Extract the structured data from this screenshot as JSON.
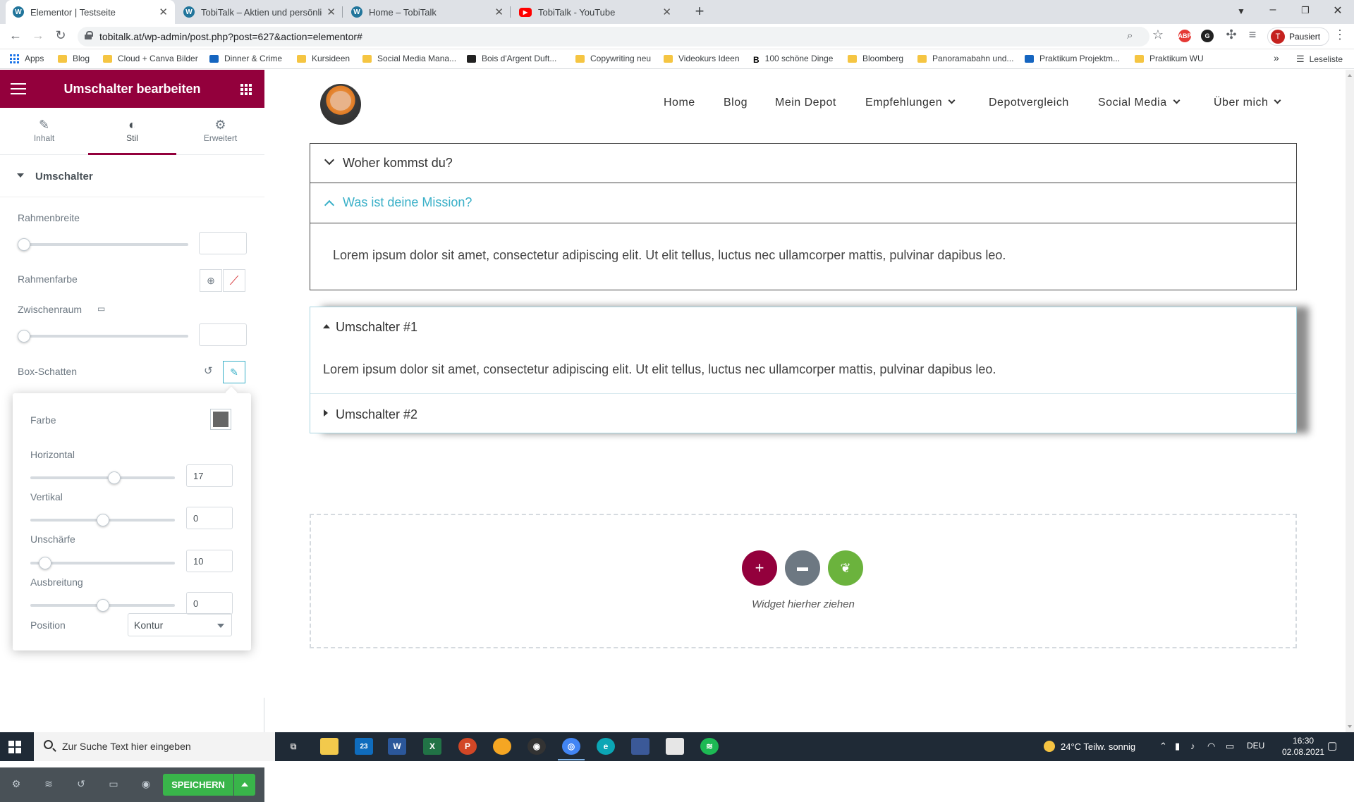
{
  "browser": {
    "tabs": [
      {
        "title": "Elementor | Testseite",
        "icon": "wordpress-icon"
      },
      {
        "title": "TobiTalk – Aktien und persönliche",
        "icon": "wordpress-icon"
      },
      {
        "title": "Home – TobiTalk",
        "icon": "wordpress-icon"
      },
      {
        "title": "TobiTalk - YouTube",
        "icon": "youtube-icon"
      }
    ],
    "new_tab": "+",
    "url": "tobitalk.at/wp-admin/post.php?post=627&action=elementor#",
    "profile_initial": "T",
    "profile_label": "Pausiert",
    "extensions": [
      "ABP",
      "G"
    ],
    "bookmarks": [
      {
        "label": "Apps"
      },
      {
        "label": "Blog"
      },
      {
        "label": "Cloud + Canva Bilder"
      },
      {
        "label": "Dinner & Crime"
      },
      {
        "label": "Kursideen"
      },
      {
        "label": "Social Media Mana..."
      },
      {
        "label": "Bois d'Argent Duft..."
      },
      {
        "label": "Copywriting neu"
      },
      {
        "label": "Videokurs Ideen"
      },
      {
        "label": "100 schöne Dinge"
      },
      {
        "label": "Bloomberg"
      },
      {
        "label": "Panoramabahn und..."
      },
      {
        "label": "Praktikum Projektm..."
      },
      {
        "label": "Praktikum WU"
      }
    ],
    "more_bookmarks": "»",
    "reading_list": "Leseliste"
  },
  "panel": {
    "title": "Umschalter bearbeiten",
    "tabs": [
      {
        "label": "Inhalt",
        "icon": "pencil-icon"
      },
      {
        "label": "Stil",
        "icon": "contrast-icon"
      },
      {
        "label": "Erweitert",
        "icon": "gear-icon"
      }
    ],
    "active_tab": "Stil",
    "section": "Umschalter",
    "controls": {
      "border_width_label": "Rahmenbreite",
      "border_width_value": "",
      "border_color_label": "Rahmenfarbe",
      "spacing_label": "Zwischenraum",
      "spacing_value": "",
      "box_shadow_label": "Box-Schatten"
    },
    "box_shadow": {
      "color_label": "Farbe",
      "color": "#666666",
      "horizontal_label": "Horizontal",
      "horizontal": "17",
      "vertical_label": "Vertikal",
      "vertical": "0",
      "blur_label": "Unschärfe",
      "blur": "10",
      "spread_label": "Ausbreitung",
      "spread": "0",
      "position_label": "Position",
      "position": "Kontur"
    },
    "slider_levels": {
      "border_width": 0,
      "spacing": 0,
      "horizontal": 0.58,
      "vertical": 0.5,
      "blur": 0.1,
      "spread": 0.5
    },
    "save_label": "SPEICHERN",
    "brand_color": "#93003c",
    "save_color": "#39b54a"
  },
  "site": {
    "nav": [
      {
        "label": "Home"
      },
      {
        "label": "Blog"
      },
      {
        "label": "Mein Depot"
      },
      {
        "label": "Empfehlungen",
        "dropdown": true
      },
      {
        "label": "Depotvergleich"
      },
      {
        "label": "Social Media",
        "dropdown": true
      },
      {
        "label": "Über mich",
        "dropdown": true
      }
    ],
    "accordion": [
      {
        "title": "Woher kommst du?",
        "open": false
      },
      {
        "title": "Was ist deine Mission?",
        "open": true
      }
    ],
    "accordion_text": "Lorem ipsum dolor sit amet, consectetur adipiscing elit. Ut elit tellus, luctus nec ullamcorper mattis, pulvinar dapibus leo.",
    "toggles": [
      {
        "title": "Umschalter #1",
        "open": true
      },
      {
        "title": "Umschalter #2",
        "open": false
      }
    ],
    "toggle_text": "Lorem ipsum dolor sit amet, consectetur adipiscing elit. Ut elit tellus, luctus nec ullamcorper mattis, pulvinar dapibus leo.",
    "dropzone_text": "Widget hierher ziehen",
    "accent_color": "#3ab0c8"
  },
  "taskbar": {
    "search_placeholder": "Zur Suche Text hier eingeben",
    "mail_badge": "23",
    "weather": "24°C  Teilw. sonnig",
    "language": "DEU",
    "time": "16:30",
    "date": "02.08.2021"
  }
}
